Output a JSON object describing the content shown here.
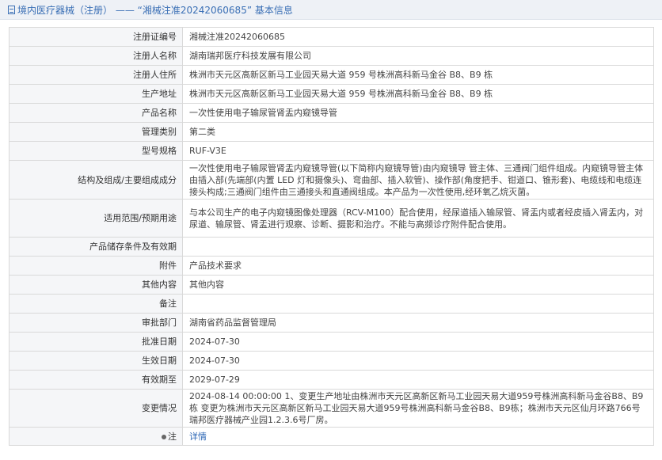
{
  "header": {
    "title": "境内医疗器械（注册） ——  “湘械注准20242060685”  基本信息"
  },
  "rows": [
    {
      "label": "注册证编号",
      "value": "湘械注准20242060685"
    },
    {
      "label": "注册人名称",
      "value": "湖南瑞邦医疗科技发展有限公司"
    },
    {
      "label": "注册人住所",
      "value": "株洲市天元区高新区新马工业园天易大道 959 号株洲高科新马金谷 B8、B9 栋"
    },
    {
      "label": "生产地址",
      "value": "株洲市天元区高新区新马工业园天易大道 959 号株洲高科新马金谷 B8、B9 栋"
    },
    {
      "label": "产品名称",
      "value": "一次性使用电子输尿管肾盂内窥镜导管"
    },
    {
      "label": "管理类别",
      "value": "第二类"
    },
    {
      "label": "型号规格",
      "value": "RUF-V3E"
    },
    {
      "label": "结构及组成/主要组成成分",
      "value": "一次性使用电子输尿管肾盂内窥镜导管(以下简称内窥镜导管)由内窥镜导 管主体、三通阀门组件组成。内窥镜导管主体由插入部(先端部(内置 LED 灯和摄像头)、弯曲部、插入软管)、操作部(角度把手、钳道口、锥形套)、电缆线和电缆连接头构成;三通阀门组件由三通接头和直通阀组成。本产品为一次性使用,经环氧乙烷灭菌。"
    },
    {
      "label": "适用范围/预期用途",
      "value": "与本公司生产的电子内窥镜图像处理器（RCV-M100）配合使用，经尿道插入输尿管、肾盂内或者经皮插入肾盂内，对尿道、输尿管、肾盂进行观察、诊断、摄影和治疗。不能与高频诊疗附件配合使用。"
    },
    {
      "label": "产品储存条件及有效期",
      "value": ""
    },
    {
      "label": "附件",
      "value": "产品技术要求"
    },
    {
      "label": "其他内容",
      "value": "其他内容"
    },
    {
      "label": "备注",
      "value": ""
    },
    {
      "label": "审批部门",
      "value": "湖南省药品监督管理局"
    },
    {
      "label": "批准日期",
      "value": "2024-07-30"
    },
    {
      "label": "生效日期",
      "value": "2024-07-30"
    },
    {
      "label": "有效期至",
      "value": "2029-07-29"
    },
    {
      "label": "变更情况",
      "value": "2024-08-14 00:00:00 1、变更生产地址由株洲市天元区高新区新马工业园天易大道959号株洲高科新马金谷B8、B9栋 变更为株洲市天元区高新区新马工业园天易大道959号株洲高科新马金谷B8、B9栋；株洲市天元区仙月环路766号瑞邦医疗器械产业园1.2.3.6号厂房。"
    }
  ],
  "note": {
    "label": "注",
    "link": "详情"
  }
}
